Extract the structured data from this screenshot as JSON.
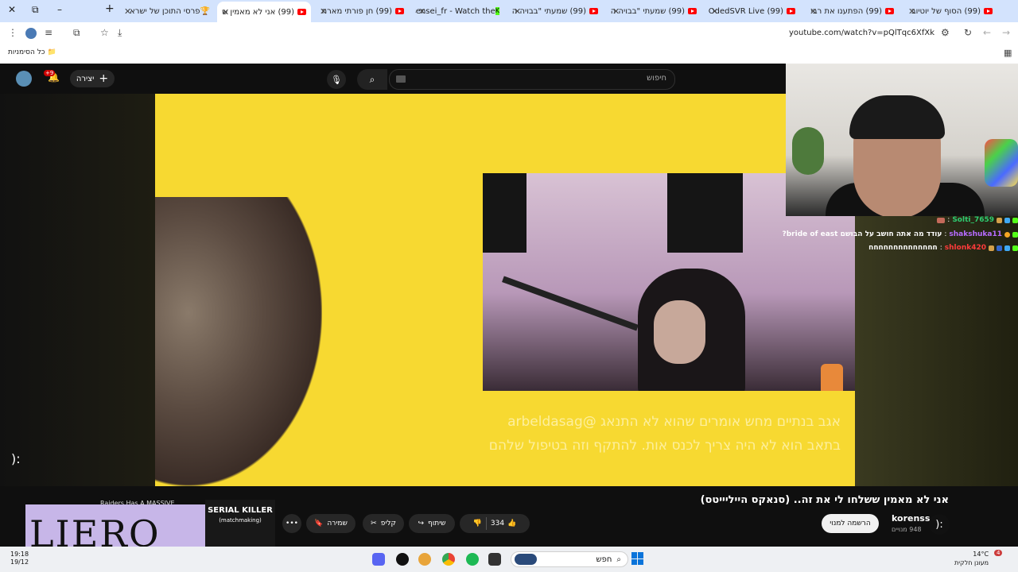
{
  "browser": {
    "tabs": [
      {
        "label": "(99) הסוף של יוטיוב",
        "active": false
      },
      {
        "label": "(99) הפתענו את רבי",
        "active": false
      },
      {
        "label": "(99) OdedSVR Live",
        "active": false
      },
      {
        "label": "(99) שמעתי \"בבויה ה",
        "active": false
      },
      {
        "label": "(99) שמעתי \"בבויה ה",
        "active": false
      },
      {
        "label": "sensei_fr - Watch the",
        "active": false
      },
      {
        "label": "(99) חן פורתי מארח",
        "active": false
      },
      {
        "label": "(99) אני לא מאמין ש",
        "active": true
      },
      {
        "label": "פרסי התוכן של ישרא",
        "active": false
      }
    ],
    "new_tab_label": "+",
    "url": "youtube.com/watch?v=pQlTqc6XfXk",
    "bookmarks_all": "כל הסימניות"
  },
  "youtube_header": {
    "search_placeholder": "חיפוש",
    "create_label": "יצירה",
    "notifications_badge": "+9"
  },
  "video": {
    "overlay_text": "אגב בנתיים מחש אומרים שהוא לא התנאג @arbeldasag בתאב הוא לא היה צריך לכנס אות. להתקף וזה בטיפול שלהם",
    "left_sad_face": "):"
  },
  "chat": [
    {
      "user": "Solti_7659",
      "message": "",
      "user_color": "#2ecc71"
    },
    {
      "user": "shakshuka11",
      "message": "עודד מה אתה חושב על הבושם bride of east?",
      "user_color": "#b76cff"
    },
    {
      "user": "shlonk420",
      "message": "חחחחחחחחחחחחחח",
      "user_color": "#ff3b3b"
    }
  ],
  "below_video": {
    "title": "אני לא מאמין ששלחו לי את זה.. (סנאקס הייליייטס)",
    "channel_name": "korenss",
    "channel_avatar": "):",
    "subscribers": "948 מנויים",
    "subscribe_label": "הרשמה למנוי",
    "like_count": "334",
    "share_label": "שיתוף",
    "clip_label": "קליפ",
    "save_label": "שמירה",
    "more_label": "•••",
    "ad_text": "LIERO",
    "thumb_title": "SERIAL KILLER",
    "thumb_sub": "(matchmaking)",
    "next_title": "Raiders Has A MASSIVE"
  },
  "taskbar": {
    "time": "19:18",
    "date": "19/12",
    "search_label": "חפש",
    "weather_temp": "14°C",
    "weather_desc": "מעונן חלקית",
    "notif_count": "4"
  },
  "colors": {
    "yt_red": "#ff0000",
    "video_yellow": "#f7d931",
    "tab_strip": "#d3e3fd"
  }
}
